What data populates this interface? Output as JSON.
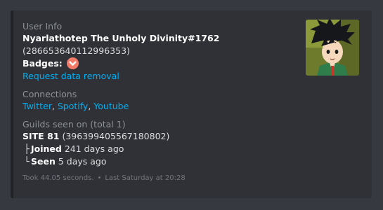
{
  "embed": {
    "user_info": {
      "heading": "User Info",
      "username": "Nyarlathotep The Unholy Divinity#1762",
      "user_id": "(286653640112996353)",
      "badges_label": "Badges:",
      "badge_icon": "hypesquad-balance-chevron-icon",
      "request_link": "Request data removal"
    },
    "connections": {
      "heading": "Connections",
      "links": [
        "Twitter",
        "Spotify",
        "Youtube"
      ],
      "separator": ", "
    },
    "guilds": {
      "heading": "Guilds seen on (total 1)",
      "guild_name": "SITE 81",
      "guild_id": "(396399405567180802)",
      "joined_label": "Joined",
      "joined_value": "241 days ago",
      "seen_label": "Seen",
      "seen_value": "5 days ago",
      "tree_mid": "├",
      "tree_end": "└"
    },
    "footer": {
      "took": "Took 44.05 seconds.",
      "separator": "•",
      "timestamp": "Last Saturday at 20:28"
    },
    "thumbnail": {
      "icon": "anime-avatar-thumbnail"
    }
  },
  "colors": {
    "background": "#36393f",
    "embed_background": "#2f3136",
    "link": "#00aff4",
    "badge": "#f47b67"
  }
}
